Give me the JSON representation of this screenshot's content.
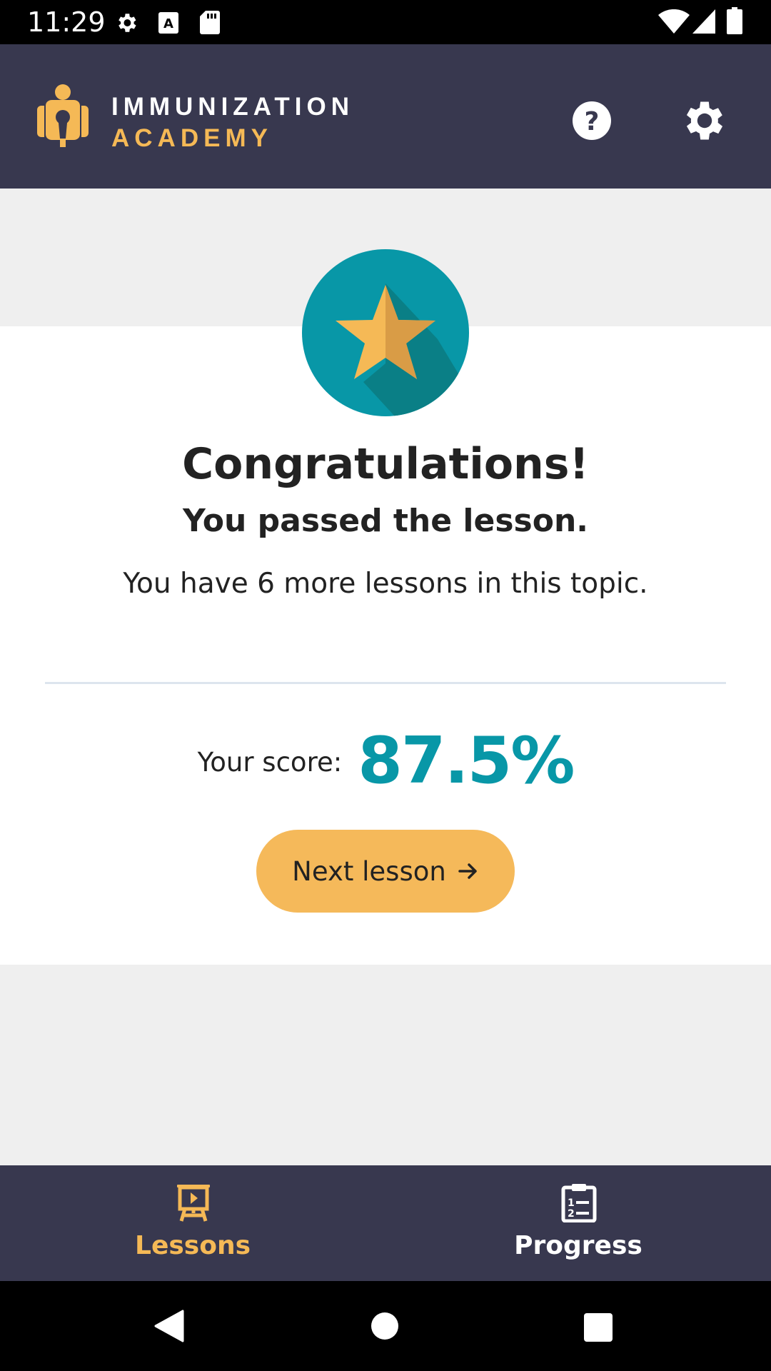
{
  "status_bar": {
    "time": "11:29",
    "icons": [
      "settings-icon",
      "text-a-icon",
      "sd-card-icon",
      "wifi-icon",
      "signal-icon",
      "battery-icon"
    ]
  },
  "header": {
    "logo_line1": "IMMUNIZATION",
    "logo_line2": "ACADEMY",
    "help_icon": "help-icon",
    "settings_icon": "gear-icon"
  },
  "result": {
    "badge_icon": "star-icon",
    "title": "Congratulations!",
    "subtitle": "You passed the lesson.",
    "remaining": "You have 6 more lessons in this topic.",
    "score_label": "Your score:",
    "score_value": "87.5%",
    "next_button": "Next lesson"
  },
  "bottom_nav": {
    "items": [
      {
        "label": "Lessons",
        "icon": "presentation-icon",
        "active": true
      },
      {
        "label": "Progress",
        "icon": "clipboard-icon",
        "active": false
      }
    ]
  },
  "system_nav": {
    "buttons": [
      "back-button",
      "home-button",
      "recents-button"
    ]
  },
  "colors": {
    "header_bg": "#38384f",
    "accent_yellow": "#f5b956",
    "accent_teal": "#0897a7",
    "card_bg": "#ffffff",
    "page_bg": "#efefef"
  }
}
